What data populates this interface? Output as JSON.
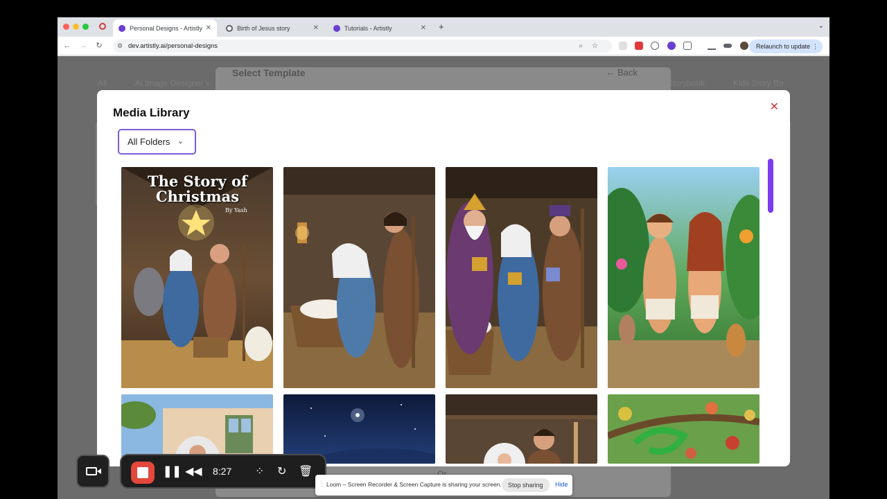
{
  "browser": {
    "tabs": [
      {
        "title": "Personal Designs - Artistly",
        "active": true
      },
      {
        "title": "Birth of Jesus story",
        "active": false
      },
      {
        "title": "Tutorials - Artistly",
        "active": false
      }
    ],
    "url": "dev.artistly.ai/personal-designs",
    "relaunch_label": "Relaunch to update"
  },
  "background": {
    "tabs": [
      "All",
      "Ai Image Designer v",
      "Storybook",
      "Kids Story Bo"
    ],
    "template_title": "Select Template",
    "back_label": "Back",
    "or_label": "Or"
  },
  "modal": {
    "title": "Media Library",
    "folder_value": "All Folders",
    "items": [
      {
        "caption_title": "The Story of Christmas",
        "caption_author": "By Yash",
        "scene": "nativity-cover"
      },
      {
        "scene": "mary-joseph-manger"
      },
      {
        "scene": "wise-men-gifts"
      },
      {
        "scene": "adam-eve-garden"
      },
      {
        "scene": "village-house"
      },
      {
        "scene": "starry-night"
      },
      {
        "scene": "stable-interior"
      },
      {
        "scene": "serpent-apple-tree"
      }
    ]
  },
  "loom": {
    "time": "8:27"
  },
  "share_banner": {
    "text": "Loom – Screen Recorder & Screen Capture is sharing your screen.",
    "stop_label": "Stop sharing",
    "hide_label": "Hide"
  },
  "colors": {
    "accent": "#7c5cd6",
    "scrollbar": "#7b3cf0",
    "close": "#c4383d",
    "record": "#e4473c"
  }
}
